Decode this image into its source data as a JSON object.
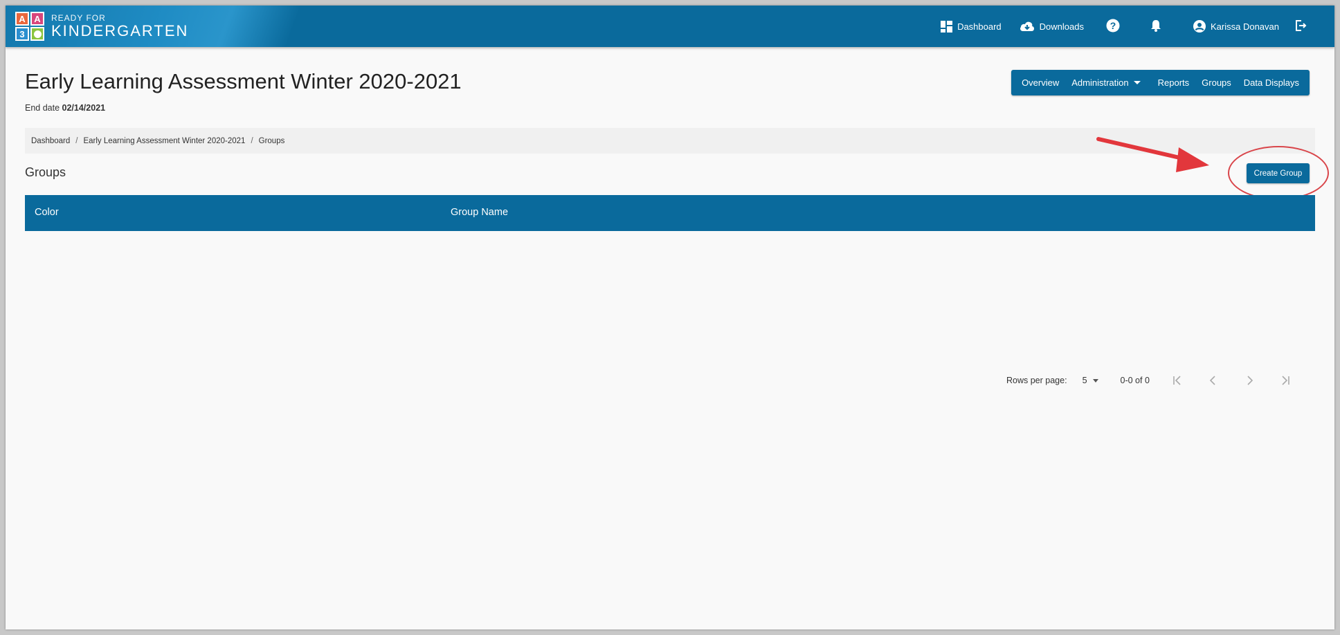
{
  "brand": {
    "line1": "READY FOR",
    "line2": "KINDERGARTEN",
    "blocks": [
      "A",
      "A",
      "3",
      ""
    ]
  },
  "topnav": {
    "dashboard": "Dashboard",
    "downloads": "Downloads",
    "user_name": "Karissa Donavan"
  },
  "page": {
    "title": "Early Learning Assessment Winter 2020-2021",
    "end_date_label": "End date",
    "end_date_value": "02/14/2021"
  },
  "subnav": {
    "overview": "Overview",
    "administration": "Administration",
    "reports": "Reports",
    "groups": "Groups",
    "data_displays": "Data Displays"
  },
  "breadcrumb": [
    "Dashboard",
    "Early Learning Assessment Winter 2020-2021",
    "Groups"
  ],
  "section": {
    "title": "Groups",
    "create_button": "Create Group"
  },
  "table": {
    "columns": [
      "Color",
      "Group Name"
    ],
    "rows": []
  },
  "pagination": {
    "rows_per_page_label": "Rows per page:",
    "rows_per_page_value": "5",
    "range": "0-0 of 0"
  },
  "colors": {
    "primary": "#0a6a9c",
    "annotation": "#d9454a"
  }
}
